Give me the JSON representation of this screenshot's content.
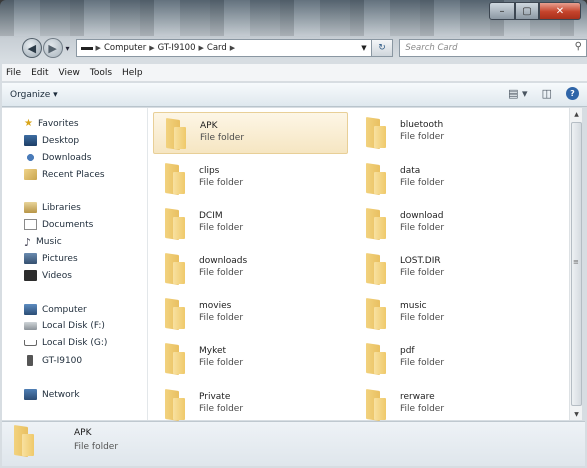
{
  "window": {
    "controls": {
      "minimize": "–",
      "maximize": "▢",
      "close": "✕"
    }
  },
  "address": {
    "crumbs": [
      "Computer",
      "GT-I9100",
      "Card"
    ],
    "search_placeholder": "Search Card"
  },
  "menu": [
    "File",
    "Edit",
    "View",
    "Tools",
    "Help"
  ],
  "commands": {
    "organize": "Organize ▾"
  },
  "nav": {
    "favorites": {
      "label": "Favorites",
      "items": [
        "Desktop",
        "Downloads",
        "Recent Places"
      ]
    },
    "libraries": {
      "label": "Libraries",
      "items": [
        "Documents",
        "Music",
        "Pictures",
        "Videos"
      ]
    },
    "computer": {
      "label": "Computer",
      "items": [
        "Local Disk (F:)",
        "Local Disk (G:)",
        "GT-I9100"
      ]
    },
    "network": {
      "label": "Network"
    }
  },
  "files": [
    {
      "name": "APK",
      "type": "File folder",
      "selected": true
    },
    {
      "name": "bluetooth",
      "type": "File folder"
    },
    {
      "name": "clips",
      "type": "File folder"
    },
    {
      "name": "data",
      "type": "File folder"
    },
    {
      "name": "DCIM",
      "type": "File folder"
    },
    {
      "name": "download",
      "type": "File folder"
    },
    {
      "name": "downloads",
      "type": "File folder"
    },
    {
      "name": "LOST.DIR",
      "type": "File folder"
    },
    {
      "name": "movies",
      "type": "File folder"
    },
    {
      "name": "music",
      "type": "File folder"
    },
    {
      "name": "Myket",
      "type": "File folder"
    },
    {
      "name": "pdf",
      "type": "File folder"
    },
    {
      "name": "Private",
      "type": "File folder"
    },
    {
      "name": "rerware",
      "type": "File folder"
    }
  ],
  "details": {
    "name": "APK",
    "type": "File folder"
  }
}
